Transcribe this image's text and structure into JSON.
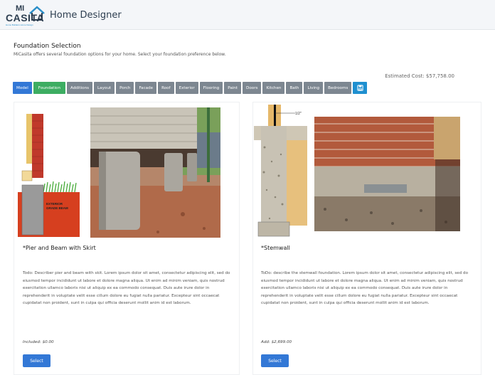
{
  "header": {
    "logo_mi": "MI",
    "logo_casita": "CASITA",
    "logo_tagline": "Home Builders Home Design",
    "title": "Home Designer"
  },
  "section": {
    "title": "Foundation Selection",
    "description": "MiCasita offers several foundation options for your home. Select your foundation preference below."
  },
  "estimated_cost": "Estimated Cost: $57,758.00",
  "tabs": [
    {
      "label": "Model"
    },
    {
      "label": "Foundation",
      "active": true
    },
    {
      "label": "Additions"
    },
    {
      "label": "Layout"
    },
    {
      "label": "Porch"
    },
    {
      "label": "Facade"
    },
    {
      "label": "Roof"
    },
    {
      "label": "Exterior"
    },
    {
      "label": "Flooring"
    },
    {
      "label": "Paint"
    },
    {
      "label": "Doors"
    },
    {
      "label": "Kitchen"
    },
    {
      "label": "Bath"
    },
    {
      "label": "Living"
    },
    {
      "label": "Bedrooms"
    }
  ],
  "options": [
    {
      "title": "*Pier and Beam with Skirt",
      "description": "Todo: Describer pier and beam with skit. Lorem ipsum dolor sit amet, consectetur adipiscing elit, sed do eiusmod tempor incididunt ut labore et dolore magna aliqua. Ut enim ad minim veniam, quis nostrud exercitation ullamco laboris nisi ut aliquip ex ea commodo consequat. Duis aute irure dolor in reprehenderit in voluptate velit esse cillum dolore eu fugiat nulla pariatur. Excepteur sint occaecat cupidatat non proident, sunt in culpa qui officia deserunt mollit anim id est laborum.",
      "price": "Included: $0.00",
      "button": "Select",
      "diagram_label": "EXTERIOR GRADE BEAM"
    },
    {
      "title": "*Stemwall",
      "description": "ToDo: describe the stemwall foundation. Lorem ipsum dolor sit amet, consectetur adipiscing elit, sed do eiusmod tempor incididunt ut labore et dolore magna aliqua. Ut enim ad minim veniam, quis nostrud exercitation ullamco laboris nisi ut aliquip ex ea commodo consequat. Duis aute irure dolor in reprehenderit in voluptate velit esse cillum dolore eu fugiat nulla pariatur. Excepteur sint occaecat cupidatat non proident, sunt in culpa qui officia deserunt mollit anim id est laborum.",
      "price": "Add: $2,699.00",
      "button": "Select",
      "diagram_label": "1/2\""
    }
  ],
  "colors": {
    "primary": "#3378d6",
    "active_tab": "#3dad62",
    "tab": "#7d8791",
    "icon_tab": "#1f90d0"
  },
  "icons": {
    "save_tab": "save-icon",
    "logo_house": "house-icon"
  }
}
